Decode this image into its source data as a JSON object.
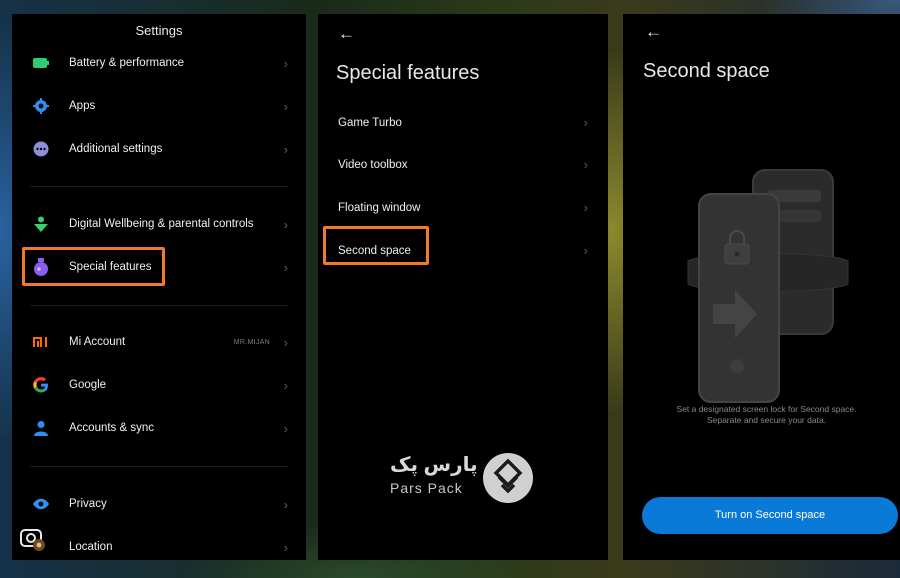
{
  "panel1": {
    "title": "Settings",
    "items": [
      {
        "label": "Battery & performance",
        "icon": "battery-icon",
        "color": "#2ecc71"
      },
      {
        "label": "Apps",
        "icon": "gear-icon",
        "color": "#2f8ff0"
      },
      {
        "label": "Additional settings",
        "icon": "more-dots-icon",
        "color": "#8b8fd6"
      },
      {
        "label": "Digital Wellbeing & parental controls",
        "icon": "wellbeing-icon",
        "color": "#3ccf6a"
      },
      {
        "label": "Special features",
        "icon": "flask-icon",
        "color": "#8a5cf0"
      },
      {
        "label": "Mi Account",
        "icon": "mi-logo-icon",
        "aux": "MR.MIJAN",
        "color": "#ff6900"
      },
      {
        "label": "Google",
        "icon": "google-icon"
      },
      {
        "label": "Accounts & sync",
        "icon": "person-icon",
        "color": "#2f8ff0"
      },
      {
        "label": "Privacy",
        "icon": "eye-icon",
        "color": "#2f8ff0"
      },
      {
        "label": "Location",
        "icon": "location-icon"
      }
    ]
  },
  "panel2": {
    "title": "Special features",
    "items": [
      {
        "label": "Game Turbo"
      },
      {
        "label": "Video toolbox"
      },
      {
        "label": "Floating window"
      },
      {
        "label": "Second space"
      }
    ]
  },
  "panel3": {
    "title": "Second space",
    "description_line1": "Set a designated screen lock for Second space.",
    "description_line2": "Separate and secure your data.",
    "button_label": "Turn on Second space"
  },
  "watermark": {
    "text_fa": "پارس پک",
    "text_en": "Pars Pack"
  },
  "colors": {
    "highlight": "#f07a2a",
    "accent_blue": "#0a7ad8"
  }
}
